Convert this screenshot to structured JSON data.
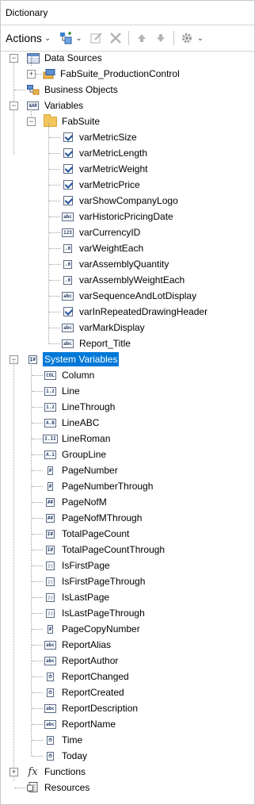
{
  "window": {
    "title": "Dictionary"
  },
  "toolbar": {
    "actions_label": "Actions"
  },
  "tree": {
    "data_sources": {
      "label": "Data Sources",
      "children": [
        {
          "label": "FabSuite_ProductionControl"
        }
      ]
    },
    "business_objects": {
      "label": "Business Objects"
    },
    "variables": {
      "label": "Variables",
      "folder": {
        "label": "FabSuite",
        "items": [
          {
            "label": "varMetricSize",
            "type": "bool",
            "tag": ""
          },
          {
            "label": "varMetricLength",
            "type": "bool",
            "tag": ""
          },
          {
            "label": "varMetricWeight",
            "type": "bool",
            "tag": ""
          },
          {
            "label": "varMetricPrice",
            "type": "bool",
            "tag": ""
          },
          {
            "label": "varShowCompanyLogo",
            "type": "bool",
            "tag": ""
          },
          {
            "label": "varHistoricPricingDate",
            "type": "string",
            "tag": "abc"
          },
          {
            "label": "varCurrencyID",
            "type": "int",
            "tag": "123"
          },
          {
            "label": "varWeightEach",
            "type": "decimal",
            "tag": ".0"
          },
          {
            "label": "varAssemblyQuantity",
            "type": "decimal",
            "tag": ".0"
          },
          {
            "label": "varAssemblyWeightEach",
            "type": "decimal",
            "tag": ".0"
          },
          {
            "label": "varSequenceAndLotDisplay",
            "type": "string",
            "tag": "abc"
          },
          {
            "label": "varInRepeatedDrawingHeader",
            "type": "bool",
            "tag": ""
          },
          {
            "label": "varMarkDisplay",
            "type": "string",
            "tag": "abc"
          },
          {
            "label": "Report_Title",
            "type": "string",
            "tag": "abc"
          }
        ]
      }
    },
    "system_variables": {
      "label": "System Variables",
      "items": [
        {
          "label": "Column",
          "tag": "COL"
        },
        {
          "label": "Line",
          "tag": "1.2"
        },
        {
          "label": "LineThrough",
          "tag": "1.2"
        },
        {
          "label": "LineABC",
          "tag": "A.B"
        },
        {
          "label": "LineRoman",
          "tag": "I.II"
        },
        {
          "label": "GroupLine",
          "tag": "A.1"
        },
        {
          "label": "PageNumber",
          "tag": "#"
        },
        {
          "label": "PageNumberThrough",
          "tag": "#"
        },
        {
          "label": "PageNofM",
          "tag": "##"
        },
        {
          "label": "PageNofMThrough",
          "tag": "##"
        },
        {
          "label": "TotalPageCount",
          "tag": "Σ#"
        },
        {
          "label": "TotalPageCountThrough",
          "tag": "Σ#"
        },
        {
          "label": "IsFirstPage",
          "tag": "▯▯"
        },
        {
          "label": "IsFirstPageThrough",
          "tag": "▯▯"
        },
        {
          "label": "IsLastPage",
          "tag": "▯▯"
        },
        {
          "label": "IsLastPageThrough",
          "tag": "▯▯"
        },
        {
          "label": "PageCopyNumber",
          "tag": "#"
        },
        {
          "label": "ReportAlias",
          "tag": "abc"
        },
        {
          "label": "ReportAuthor",
          "tag": "abc"
        },
        {
          "label": "ReportChanged",
          "tag": "⏱"
        },
        {
          "label": "ReportCreated",
          "tag": "⏱"
        },
        {
          "label": "ReportDescription",
          "tag": "abc"
        },
        {
          "label": "ReportName",
          "tag": "abc"
        },
        {
          "label": "Time",
          "tag": "⏱"
        },
        {
          "label": "Today",
          "tag": "⏱"
        }
      ]
    },
    "functions": {
      "label": "Functions",
      "icon_text": "fx"
    },
    "resources": {
      "label": "Resources"
    }
  },
  "colors": {
    "selection": "#0078d7",
    "tag_border": "#5a6a86",
    "folder": "#f2c55c"
  }
}
